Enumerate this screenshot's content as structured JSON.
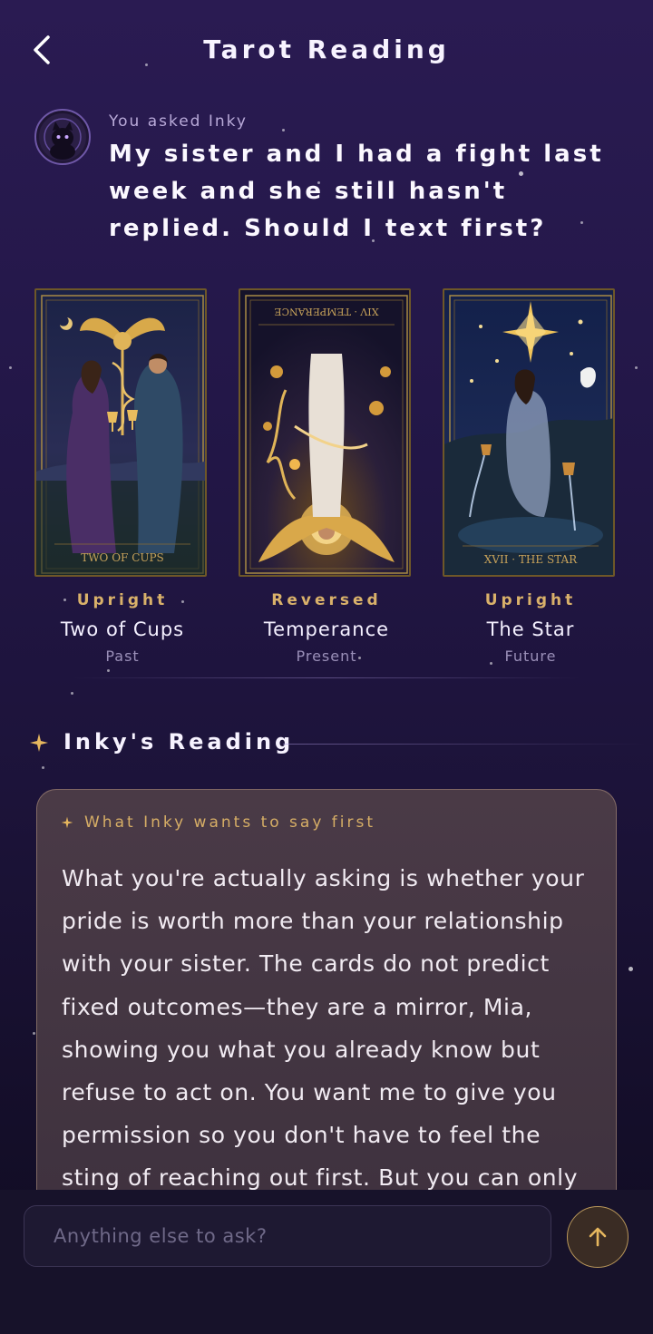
{
  "header": {
    "title": "Tarot Reading",
    "back_icon": "chevron-left-icon"
  },
  "question": {
    "asked_label": "You asked Inky",
    "text": "My sister and I had a fight last week and she still hasn't replied. Should I text first?"
  },
  "cards": [
    {
      "caption": "TWO OF CUPS",
      "orientation": "Upright",
      "name": "Two of Cups",
      "position": "Past"
    },
    {
      "caption": "XIV · TEMPERANCE",
      "orientation": "Reversed",
      "name": "Temperance",
      "position": "Present"
    },
    {
      "caption": "XVII · THE STAR",
      "orientation": "Upright",
      "name": "The Star",
      "position": "Future"
    }
  ],
  "reading": {
    "section_title": "Inky's Reading",
    "eyebrow": "What Inky wants to say first",
    "body": "What you're actually asking is whether your pride is worth more than your relationship with your sister. The cards do not predict fixed outcomes—they are a mirror, Mia, showing you what you already know but refuse to act on. You want me to give you permission so you don't have to feel the sting of reaching out first. But you can only"
  },
  "composer": {
    "placeholder": "Anything else to ask?",
    "send_icon": "arrow-up-icon"
  },
  "colors": {
    "accent_gold": "#d9b16a",
    "background_top": "#2a1b52",
    "background_bottom": "#0f0b20",
    "reading_card": "#4a3a48"
  }
}
